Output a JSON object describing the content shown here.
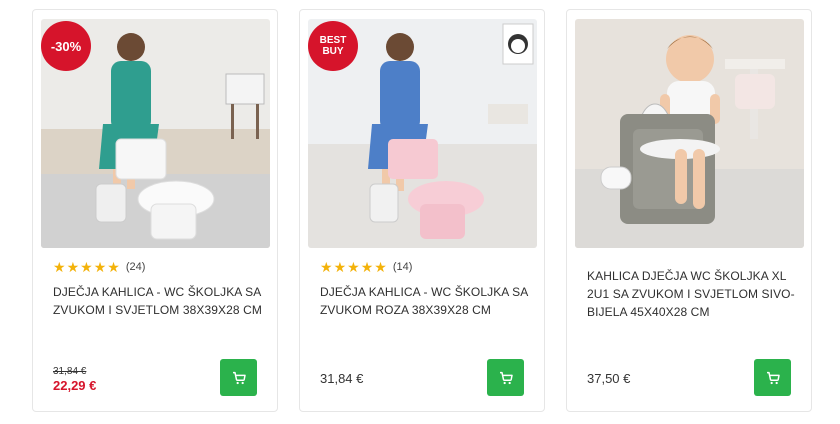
{
  "products": [
    {
      "badge": "-30%",
      "rating": 5,
      "review_count": "(24)",
      "title": "DJEČJA KAHLICA - WC ŠKOLJKA SA ZVUKOM I SVJETLOM 38x39x28 CM",
      "old_price": "31,84 €",
      "price": "22,29 €",
      "image_alt": "white toy toilet potty with toddler in teal dress",
      "cart_icon": "shopping-cart-icon"
    },
    {
      "badge_line1": "BEST",
      "badge_line2": "BUY",
      "rating": 5,
      "review_count": "(14)",
      "title": "DJEČJA KAHLICA - WC ŠKOLJKA SA ZVUKOM ROZA 38x39x28 CM",
      "price": "31,84 €",
      "image_alt": "pink toy toilet potty with toddler in blue dress",
      "cart_icon": "shopping-cart-icon"
    },
    {
      "title": "KAHLICA DJEČJA WC ŠKOLJKA XL 2u1 SA ZVUKOM I SVJETLOM SIVO-BIJELA 45x40x28 cm",
      "price": "37,50 €",
      "image_alt": "grey and white potty with smiling toddler sitting",
      "cart_icon": "shopping-cart-icon"
    }
  ],
  "colors": {
    "sale_red": "#d6142b",
    "cart_green": "#2bb24c",
    "star_gold": "#f3b20a"
  }
}
